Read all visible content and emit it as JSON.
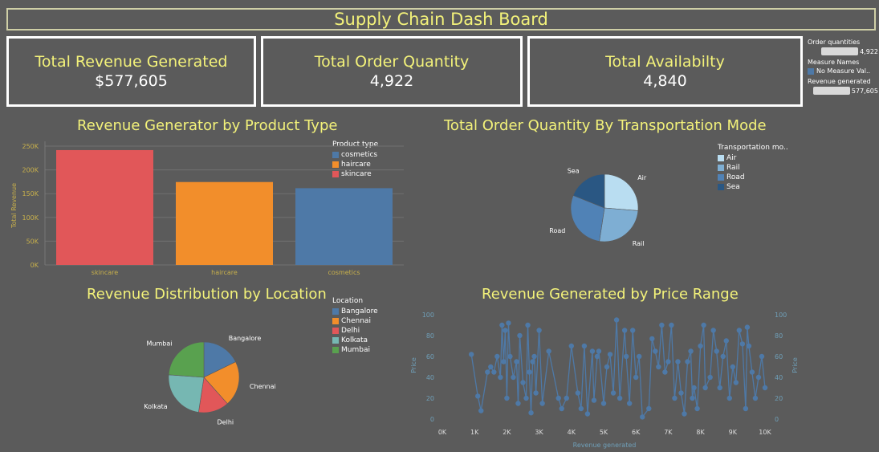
{
  "dashboard": {
    "title": "Supply Chain Dash Board"
  },
  "kpis": [
    {
      "label": "Total Revenue Generated",
      "value": "$577,605"
    },
    {
      "label": "Total Order Quantity",
      "value": "4,922"
    },
    {
      "label": "Total Availabilty",
      "value": "4,840"
    }
  ],
  "side_legend": {
    "order_label": "Order quantities",
    "order_value": "4,922",
    "measure_label": "Measure Names",
    "measure_value": "No Measure Val..",
    "revenue_label": "Revenue generated",
    "revenue_value": "577,605",
    "measure_color": "#4e79a7"
  },
  "chart_titles": {
    "bar": "Revenue Generator by Product Type",
    "transport": "Total Order Quantity By Transportation Mode",
    "location": "Revenue Distribution by Location",
    "price": "Revenue Generated by Price Range"
  },
  "legends": {
    "product": {
      "title": "Product type",
      "items": [
        {
          "label": "cosmetics",
          "color": "#4e79a7"
        },
        {
          "label": "haircare",
          "color": "#f28e2b"
        },
        {
          "label": "skincare",
          "color": "#e15759"
        }
      ]
    },
    "transport": {
      "title": "Transportation mo..",
      "items": [
        {
          "label": "Air",
          "color": "#b9ddf1"
        },
        {
          "label": "Rail",
          "color": "#7eaed3"
        },
        {
          "label": "Road",
          "color": "#5082b6"
        },
        {
          "label": "Sea",
          "color": "#2a5783"
        }
      ]
    },
    "location": {
      "title": "Location",
      "items": [
        {
          "label": "Bangalore",
          "color": "#4e79a7"
        },
        {
          "label": "Chennai",
          "color": "#f28e2b"
        },
        {
          "label": "Delhi",
          "color": "#e15759"
        },
        {
          "label": "Kolkata",
          "color": "#76b7b2"
        },
        {
          "label": "Mumbai",
          "color": "#59a14f"
        }
      ]
    }
  },
  "chart_data": [
    {
      "type": "bar",
      "title": "Revenue Generator by Product Type",
      "categories": [
        "skincare",
        "haircare",
        "cosmetics"
      ],
      "values": [
        241628,
        174455,
        161521
      ],
      "colors": [
        "#e15759",
        "#f28e2b",
        "#4e79a7"
      ],
      "ylabel": "Total Revenue",
      "yticks": [
        "250K",
        "200K",
        "150K",
        "100K",
        "50K",
        "0K"
      ],
      "ylim": [
        0,
        250000
      ]
    },
    {
      "type": "pie",
      "title": "Total Order Quantity By Transportation Mode",
      "labels": [
        "Air",
        "Rail",
        "Road",
        "Sea"
      ],
      "values": [
        1295,
        1285,
        1410,
        932
      ],
      "colors": [
        "#b9ddf1",
        "#7eaed3",
        "#5082b6",
        "#2a5783"
      ]
    },
    {
      "type": "pie",
      "title": "Revenue Distribution by Location",
      "labels": [
        "Bangalore",
        "Chennai",
        "Delhi",
        "Kolkata",
        "Mumbai"
      ],
      "values": [
        102601,
        119142,
        81027,
        137077,
        137756
      ],
      "colors": [
        "#4e79a7",
        "#f28e2b",
        "#e15759",
        "#76b7b2",
        "#59a14f"
      ]
    },
    {
      "type": "line",
      "title": "Revenue Generated by Price Range",
      "xlabel": "Revenue generated",
      "ylabel": "Price",
      "xlim": [
        0,
        10000
      ],
      "ylim": [
        0,
        100
      ],
      "xticks": [
        "0K",
        "1K",
        "2K",
        "3K",
        "4K",
        "5K",
        "6K",
        "7K",
        "8K",
        "9K",
        "10K"
      ],
      "yticks": [
        "0",
        "20",
        "40",
        "60",
        "80",
        "100"
      ],
      "color": "#4e79a7",
      "points": [
        [
          900,
          62
        ],
        [
          1100,
          22
        ],
        [
          1200,
          8
        ],
        [
          1400,
          45
        ],
        [
          1500,
          50
        ],
        [
          1600,
          45
        ],
        [
          1700,
          60
        ],
        [
          1800,
          40
        ],
        [
          1850,
          90
        ],
        [
          1900,
          55
        ],
        [
          1950,
          85
        ],
        [
          2000,
          20
        ],
        [
          2050,
          92
        ],
        [
          2100,
          60
        ],
        [
          2200,
          40
        ],
        [
          2300,
          55
        ],
        [
          2350,
          15
        ],
        [
          2400,
          80
        ],
        [
          2500,
          35
        ],
        [
          2600,
          20
        ],
        [
          2650,
          90
        ],
        [
          2700,
          45
        ],
        [
          2750,
          6
        ],
        [
          2800,
          55
        ],
        [
          2850,
          60
        ],
        [
          2900,
          25
        ],
        [
          3000,
          85
        ],
        [
          3100,
          15
        ],
        [
          3300,
          65
        ],
        [
          3600,
          20
        ],
        [
          3700,
          10
        ],
        [
          3850,
          20
        ],
        [
          4000,
          70
        ],
        [
          4200,
          25
        ],
        [
          4300,
          10
        ],
        [
          4400,
          70
        ],
        [
          4500,
          5
        ],
        [
          4650,
          65
        ],
        [
          4700,
          18
        ],
        [
          4800,
          60
        ],
        [
          4850,
          65
        ],
        [
          5000,
          15
        ],
        [
          5100,
          50
        ],
        [
          5200,
          62
        ],
        [
          5300,
          25
        ],
        [
          5400,
          95
        ],
        [
          5500,
          20
        ],
        [
          5650,
          85
        ],
        [
          5700,
          60
        ],
        [
          5800,
          15
        ],
        [
          5900,
          85
        ],
        [
          6000,
          40
        ],
        [
          6100,
          60
        ],
        [
          6200,
          2
        ],
        [
          6400,
          10
        ],
        [
          6500,
          77
        ],
        [
          6600,
          65
        ],
        [
          6700,
          50
        ],
        [
          6800,
          90
        ],
        [
          6900,
          45
        ],
        [
          7000,
          55
        ],
        [
          7100,
          90
        ],
        [
          7200,
          20
        ],
        [
          7300,
          55
        ],
        [
          7400,
          25
        ],
        [
          7500,
          5
        ],
        [
          7600,
          55
        ],
        [
          7700,
          65
        ],
        [
          7750,
          20
        ],
        [
          7800,
          30
        ],
        [
          7900,
          10
        ],
        [
          8000,
          70
        ],
        [
          8100,
          90
        ],
        [
          8150,
          30
        ],
        [
          8300,
          40
        ],
        [
          8400,
          85
        ],
        [
          8500,
          65
        ],
        [
          8600,
          30
        ],
        [
          8700,
          60
        ],
        [
          8800,
          75
        ],
        [
          8900,
          20
        ],
        [
          9000,
          50
        ],
        [
          9100,
          35
        ],
        [
          9200,
          85
        ],
        [
          9300,
          72
        ],
        [
          9400,
          10
        ],
        [
          9450,
          88
        ],
        [
          9500,
          70
        ],
        [
          9600,
          45
        ],
        [
          9700,
          20
        ],
        [
          9800,
          40
        ],
        [
          9900,
          60
        ],
        [
          10000,
          30
        ]
      ]
    }
  ]
}
